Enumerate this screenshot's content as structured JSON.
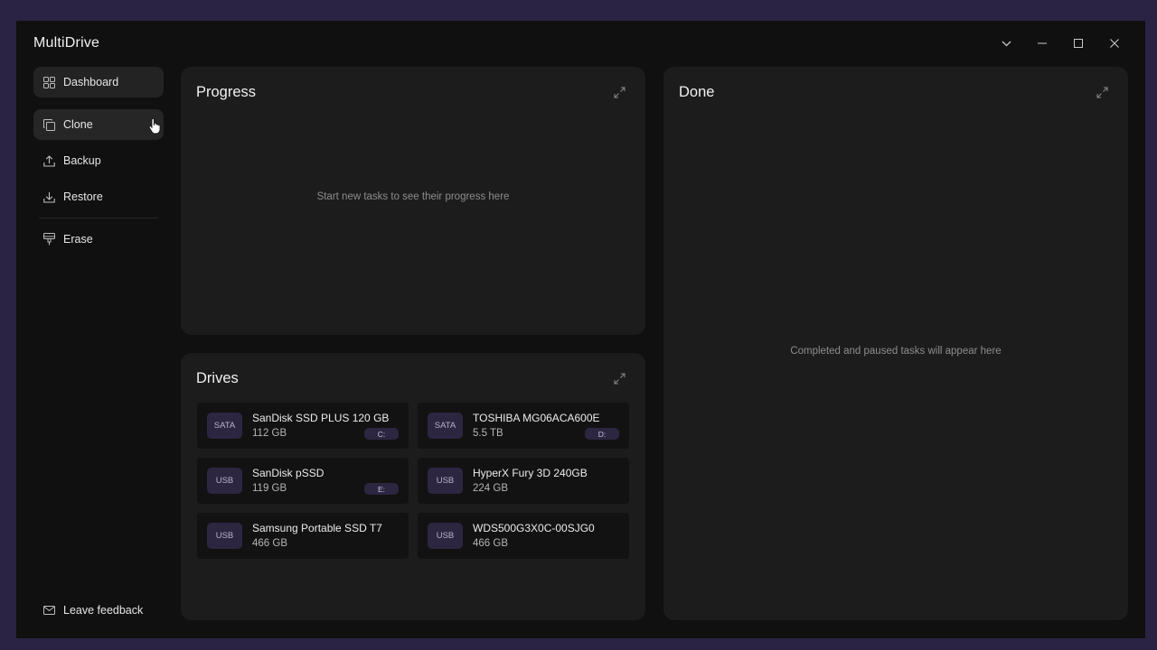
{
  "app": {
    "title": "MultiDrive"
  },
  "window_controls": {
    "dropdown": "chevron-down-icon",
    "minimize": "minimize-icon",
    "maximize": "maximize-icon",
    "close": "close-icon"
  },
  "sidebar": {
    "items": [
      {
        "label": "Dashboard",
        "icon": "dashboard-grid-icon"
      },
      {
        "label": "Clone",
        "icon": "clone-copy-icon"
      },
      {
        "label": "Backup",
        "icon": "upload-icon"
      },
      {
        "label": "Restore",
        "icon": "download-icon"
      },
      {
        "label": "Erase",
        "icon": "eraser-brush-icon"
      }
    ],
    "feedback_label": "Leave feedback"
  },
  "progress": {
    "title": "Progress",
    "empty_text": "Start new tasks to see their progress here"
  },
  "done": {
    "title": "Done",
    "empty_text": "Completed and paused tasks will appear here"
  },
  "drives": {
    "title": "Drives",
    "items": [
      {
        "type": "SATA",
        "name": "SanDisk SSD PLUS 120 GB",
        "size": "112 GB",
        "letter": "C:"
      },
      {
        "type": "SATA",
        "name": "TOSHIBA MG06ACA600E",
        "size": "5.5 TB",
        "letter": "D:"
      },
      {
        "type": "USB",
        "name": "SanDisk pSSD",
        "size": "119 GB",
        "letter": "E:"
      },
      {
        "type": "USB",
        "name": "HyperX Fury 3D 240GB",
        "size": "224 GB",
        "letter": ""
      },
      {
        "type": "USB",
        "name": "Samsung Portable SSD T7",
        "size": "466 GB",
        "letter": ""
      },
      {
        "type": "USB",
        "name": "WDS500G3X0C-00SJG0",
        "size": "466 GB",
        "letter": ""
      }
    ]
  },
  "colors": {
    "accent": "#2c2640",
    "panel": "#1c1c1c",
    "background": "#101010",
    "frame": "#2a2343"
  }
}
